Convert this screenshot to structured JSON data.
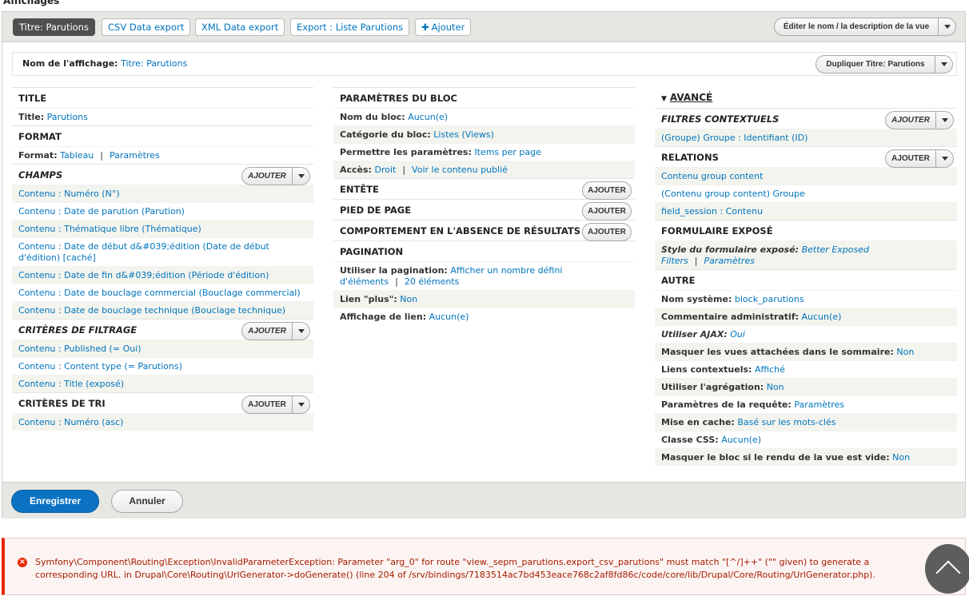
{
  "page": {
    "heading": "Affichages"
  },
  "tabs": [
    {
      "label": "Titre: Parutions",
      "active": true
    },
    {
      "label": "CSV Data export"
    },
    {
      "label": "XML Data export"
    },
    {
      "label": "Export : Liste Parutions"
    },
    {
      "label": "Ajouter"
    }
  ],
  "top_actions": {
    "edit_name_label": "Éditer le nom / la description de la vue"
  },
  "display_name": {
    "label": "Nom de l'affichage:",
    "value": "Titre: Parutions",
    "duplicate_label": "Dupliquer Titre: Parutions"
  },
  "col1": {
    "title": {
      "heading": "TITLE",
      "label": "Title:",
      "value": "Parutions"
    },
    "format": {
      "heading": "FORMAT",
      "label": "Format:",
      "value": "Tableau",
      "settings": "Paramètres"
    },
    "fields": {
      "heading": "CHAMPS",
      "add_label": "Ajouter",
      "items": [
        "Contenu : Numéro (N°)",
        "Contenu : Date de parution (Parution)",
        "Contenu : Thématique libre (Thématique)",
        "Contenu : Date de début d&#039;édition (Date de début d'édition) [caché]",
        "Contenu : Date de fin d&#039;édition (Période d'édition)",
        "Contenu : Date de bouclage commercial (Bouclage commercial)",
        "Contenu : Date de bouclage technique (Bouclage technique)"
      ]
    },
    "filters": {
      "heading": "CRITÈRES DE FILTRAGE",
      "add_label": "Ajouter",
      "items": [
        "Contenu : Published (= Oui)",
        "Contenu : Content type (= Parutions)",
        "Contenu : Title (exposé)"
      ]
    },
    "sort": {
      "heading": "CRITÈRES DE TRI",
      "add_label": "Ajouter",
      "items": [
        "Contenu : Numéro (asc)"
      ]
    }
  },
  "col2": {
    "block": {
      "heading": "PARAMÈTRES DU BLOC",
      "name_label": "Nom du bloc:",
      "name_value": "Aucun(e)",
      "category_label": "Catégorie du bloc:",
      "category_value": "Listes (Views)",
      "allow_label": "Permettre les paramètres:",
      "allow_value": "Items per page",
      "access_label": "Accès:",
      "access_value": "Droit",
      "access_value2": "Voir le contenu publié"
    },
    "header": {
      "heading": "ENTÊTE",
      "add_label": "Ajouter"
    },
    "footer": {
      "heading": "PIED DE PAGE",
      "add_label": "Ajouter"
    },
    "empty": {
      "heading": "COMPORTEMENT EN L'ABSENCE DE RÉSULTATS",
      "add_label": "Ajouter"
    },
    "pager": {
      "heading": "PAGINATION",
      "use_label": "Utiliser la pagination:",
      "use_value": "Afficher un nombre défini d'éléments",
      "use_value2": "20 éléments",
      "more_label": "Lien \"plus\":",
      "more_value": "Non",
      "link_label": "Affichage de lien:",
      "link_value": "Aucun(e)"
    }
  },
  "col3": {
    "advanced_label": "AVANCÉ",
    "contextual": {
      "heading": "FILTRES CONTEXTUELS",
      "add_label": "Ajouter",
      "items": [
        "(Groupe) Groupe : Identifiant (ID)"
      ]
    },
    "relations": {
      "heading": "RELATIONS",
      "add_label": "Ajouter",
      "items": [
        "Contenu group content",
        "(Contenu group content) Groupe",
        "field_session : Contenu"
      ]
    },
    "exposed": {
      "heading": "FORMULAIRE EXPOSÉ",
      "style_label": "Style du formulaire exposé:",
      "style_value": "Better Exposed Filters",
      "settings": "Paramètres"
    },
    "other": {
      "heading": "AUTRE",
      "rows": [
        {
          "label": "Nom système:",
          "value": "block_parutions"
        },
        {
          "label": "Commentaire administratif:",
          "value": "Aucun(e)"
        },
        {
          "label": "Utiliser AJAX:",
          "value": "Oui",
          "italic": true
        },
        {
          "label": "Masquer les vues attachées dans le sommaire:",
          "value": "Non"
        },
        {
          "label": "Liens contextuels:",
          "value": "Affiché"
        },
        {
          "label": "Utiliser l'agrégation:",
          "value": "Non"
        },
        {
          "label": "Paramètres de la requête:",
          "value": "Paramètres"
        },
        {
          "label": "Mise en cache:",
          "value": "Basé sur les mots-clés"
        },
        {
          "label": "Classe CSS:",
          "value": "Aucun(e)"
        },
        {
          "label": "Masquer le bloc si le rendu de la vue est vide:",
          "value": "Non"
        }
      ]
    }
  },
  "actions": {
    "save_label": "Enregistrer",
    "cancel_label": "Annuler"
  },
  "error": {
    "message": "Symfony\\Component\\Routing\\Exception\\InvalidParameterException: Parameter \"arg_0\" for route \"view._sepm_parutions.export_csv_parutions\" must match \"[^/]++\" (\"\" given) to generate a corresponding URL. in Drupal\\Core\\Routing\\UrlGenerator->doGenerate() (line 204 of /srv/bindings/7183514ac7bd453eace768c2af8fd86c/code/core/lib/Drupal/Core/Routing/UrlGenerator.php)."
  },
  "colors": {
    "link": "#0074bd",
    "primary": "#0a72c1",
    "error": "#e62600",
    "toolbar": "#e6e6e2"
  },
  "icons": {
    "error": "error-circle-icon",
    "scroll_top": "chevron-up-icon",
    "caret": "caret-down-icon"
  }
}
